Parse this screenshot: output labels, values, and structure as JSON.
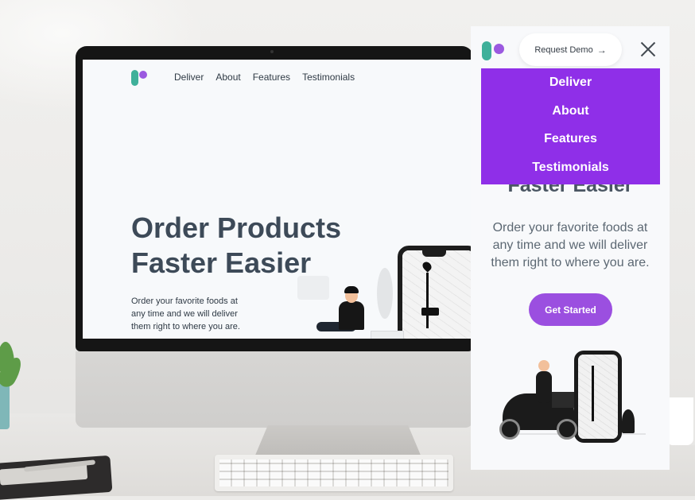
{
  "desktop_site": {
    "nav": [
      "Deliver",
      "About",
      "Features",
      "Testimonials"
    ],
    "hero_title_line1": "Order Products",
    "hero_title_line2": "Faster Easier",
    "hero_subtitle": "Order your favorite foods at any time and we will deliver them right to where you are."
  },
  "mobile_site": {
    "request_demo_label": "Request Demo",
    "request_demo_arrow": "→",
    "close_icon": "close-icon",
    "menu": [
      "Deliver",
      "About",
      "Features",
      "Testimonials"
    ],
    "hero_title_partial": "Faster Easier",
    "hero_subtitle": "Order your favorite foods at any time and we will deliver them right to where you are.",
    "cta_label": "Get Started"
  },
  "colors": {
    "brand_purple": "#8f2fe8",
    "button_purple": "#9b4fe0",
    "logo_teal": "#3fb09a",
    "logo_purple": "#9b59e0",
    "heading": "#3d4a58"
  }
}
